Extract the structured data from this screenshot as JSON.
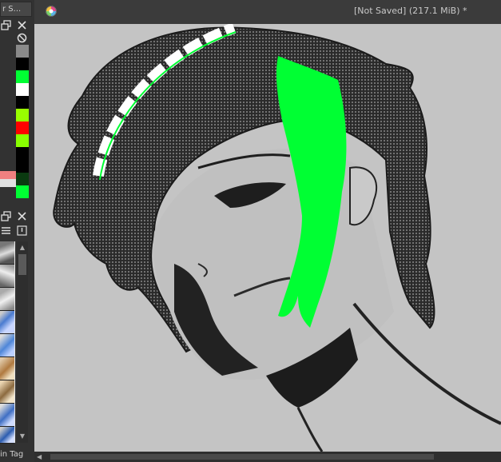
{
  "window": {
    "title": "[Not Saved]  (217.1 MiB) *"
  },
  "left_dock": {
    "tab_label": "r S...",
    "bottom_label": "in Tag"
  },
  "colors": {
    "accent_green": "#00ff33",
    "red": "#ff0000",
    "lime": "#99ff00",
    "salmon": "#f08080"
  },
  "icons": {
    "app": "krita-logo-icon",
    "float_panel": "float-panel-icon",
    "close_panel": "close-panel-icon",
    "no_color": "no-color-icon",
    "list_view": "list-view-icon",
    "options": "options-icon"
  }
}
